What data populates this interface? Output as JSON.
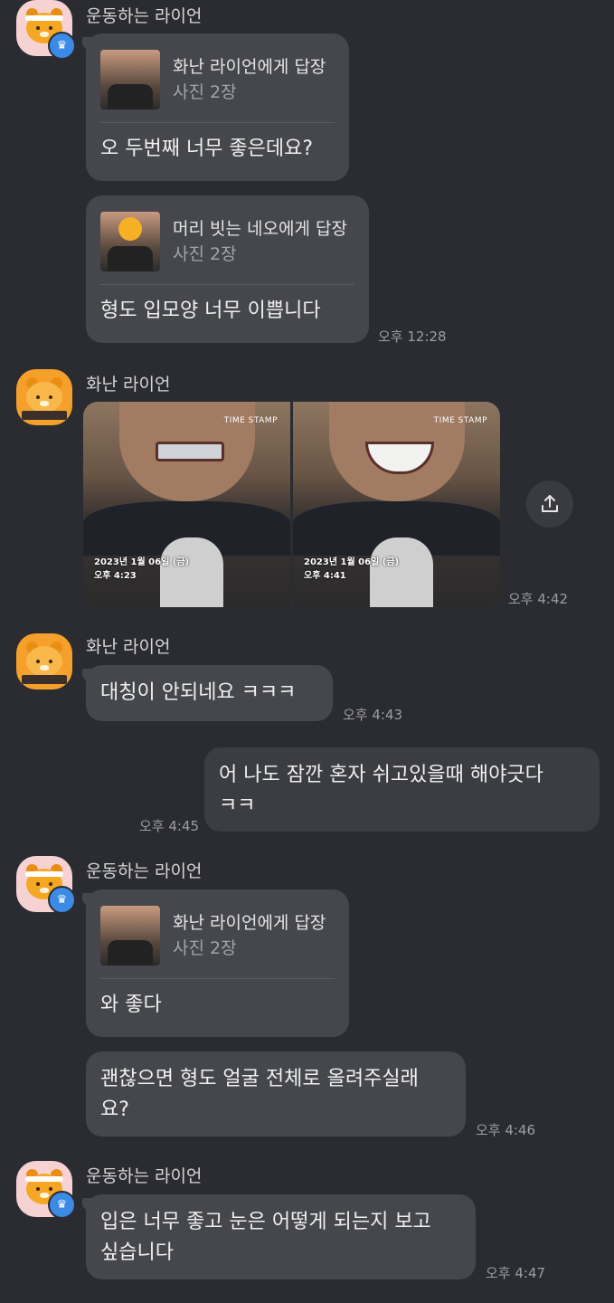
{
  "blocks": [
    {
      "sender": "운동하는 라이언",
      "bubbles": [
        {
          "reply_to": "화난 라이언에게 답장",
          "reply_sub": "사진 2장",
          "text": "오 두번째 너무 좋은데요?"
        },
        {
          "reply_to": "머리 빗는 네오에게 답장",
          "reply_sub": "사진 2장",
          "text": "형도 입모양 너무 이쁩니다"
        }
      ],
      "time": "오후 12:28"
    },
    {
      "sender": "화난 라이언",
      "photos": [
        {
          "stamp_date": "2023년 1월 06일 (금)",
          "stamp_time": "오후 4:23",
          "watermark": "TIME STAMP"
        },
        {
          "stamp_date": "2023년 1월 06일 (금)",
          "stamp_time": "오후 4:41",
          "watermark": "TIME STAMP"
        }
      ],
      "time": "오후 4:42"
    },
    {
      "sender": "화난 라이언",
      "bubbles": [
        {
          "text": "대칭이 안되네요 ㅋㅋㅋ"
        }
      ],
      "time": "오후 4:43"
    },
    {
      "mine": true,
      "bubbles": [
        {
          "line1": "어 나도 잠깐 혼자 쉬고있을때 해야긋다",
          "line2": "ㅋㅋ"
        }
      ],
      "time": "오후 4:45"
    },
    {
      "sender": "운동하는 라이언",
      "bubbles": [
        {
          "reply_to": "화난 라이언에게 답장",
          "reply_sub": "사진 2장",
          "text": "와 좋다"
        },
        {
          "line1": "괜찮으면 형도 얼굴 전체로 올려주실래",
          "line2": "요?"
        }
      ],
      "time": "오후 4:46"
    },
    {
      "sender": "운동하는 라이언",
      "bubbles": [
        {
          "line1": "입은 너무 좋고 눈은 어떻게 되는지 보고",
          "line2": "싶습니다"
        }
      ],
      "time": "오후 4:47"
    }
  ],
  "icons": {
    "share": "share-icon",
    "crown": "crown-icon"
  },
  "colors": {
    "background": "#2b2c31",
    "bubble": "#46474d",
    "badge": "#3b8ae6"
  }
}
